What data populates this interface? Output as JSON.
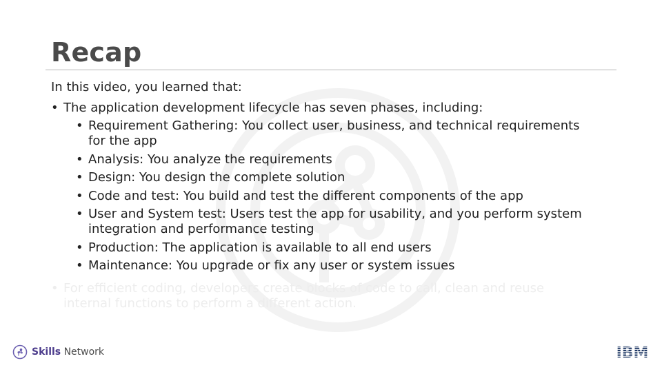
{
  "slide": {
    "title": "Recap",
    "intro": "In this video, you learned that:",
    "bullets": [
      {
        "text": "The application development lifecycle has seven phases, including:",
        "sub": [
          "Requirement Gathering: You collect user, business, and technical requirements for the app",
          "Analysis: You analyze the requirements",
          "Design: You design the complete solution",
          "Code and test: You build and test the different components of the app",
          "User and System test: Users test the app for usability, and you perform system integration and performance testing",
          "Production: The application is available to all end users",
          "Maintenance: You upgrade or fix any user or system issues"
        ]
      }
    ],
    "faded_bullet": "For efficient coding, developers create blocks of code to call, clean and reuse internal functions to perform a different action."
  },
  "footer": {
    "brand_bold": "Skills",
    "brand_rest": " Network",
    "brand_logo_icon": "skills-network-logo-icon",
    "company_logo": "IBM"
  },
  "colors": {
    "title": "#4a4a4a",
    "text": "#222222",
    "rule": "#b4b4b4",
    "brand_purple": "#4c3c8c",
    "ibm_navy": "#1f3864"
  }
}
